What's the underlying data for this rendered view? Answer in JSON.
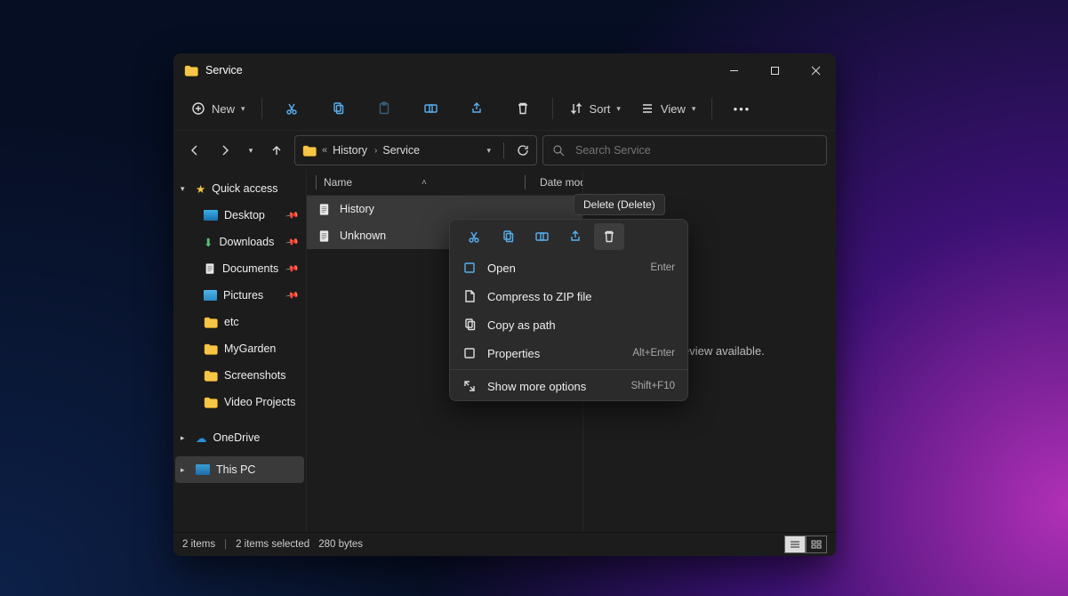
{
  "window": {
    "title": "Service"
  },
  "toolbar": {
    "new": "New",
    "sort": "Sort",
    "view": "View"
  },
  "breadcrumb": {
    "seg1": "History",
    "seg2": "Service"
  },
  "search": {
    "placeholder": "Search Service"
  },
  "columns": {
    "name": "Name",
    "modified": "Date modified"
  },
  "files": [
    {
      "name": "History"
    },
    {
      "name": "Unknown"
    }
  ],
  "sidebar": {
    "quick": "Quick access",
    "items": [
      {
        "label": "Desktop",
        "pinned": true
      },
      {
        "label": "Downloads",
        "pinned": true
      },
      {
        "label": "Documents",
        "pinned": true
      },
      {
        "label": "Pictures",
        "pinned": true
      },
      {
        "label": "etc",
        "pinned": false
      },
      {
        "label": "MyGarden",
        "pinned": false
      },
      {
        "label": "Screenshots",
        "pinned": false
      },
      {
        "label": "Video Projects",
        "pinned": false
      }
    ],
    "onedrive": "OneDrive",
    "thispc": "This PC"
  },
  "preview": {
    "empty": "No preview available."
  },
  "status": {
    "count": "2 items",
    "selected": "2 items selected",
    "size": "280 bytes"
  },
  "tooltip": {
    "text": "Delete (Delete)"
  },
  "contextmenu": {
    "open": {
      "label": "Open",
      "hotkey": "Enter"
    },
    "zip": {
      "label": "Compress to ZIP file",
      "hotkey": ""
    },
    "copypath": {
      "label": "Copy as path",
      "hotkey": ""
    },
    "properties": {
      "label": "Properties",
      "hotkey": "Alt+Enter"
    },
    "more": {
      "label": "Show more options",
      "hotkey": "Shift+F10"
    }
  }
}
